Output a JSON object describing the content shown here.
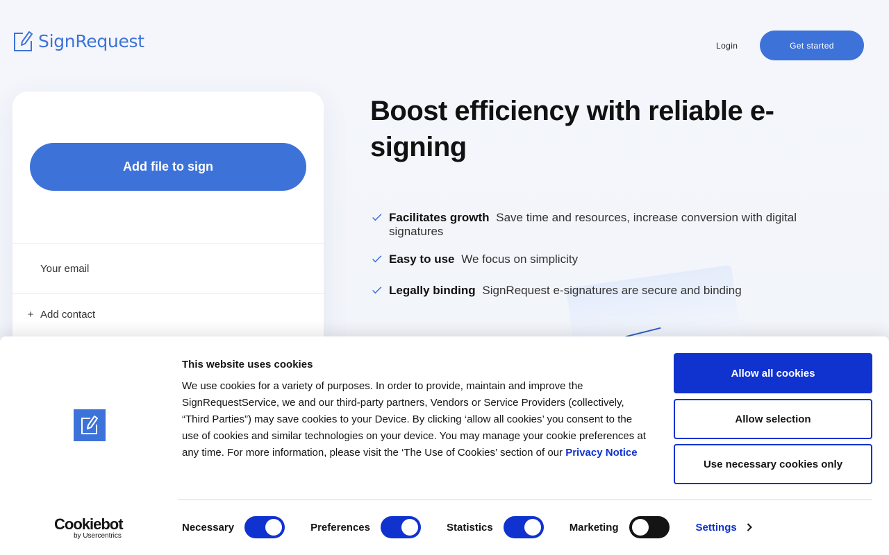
{
  "header": {
    "logo_text": "SignRequest",
    "login_label": "Login",
    "get_started_label": "Get started"
  },
  "card": {
    "add_file_label": "Add file to sign",
    "email_placeholder": "Your email",
    "add_contact_label": "Add contact"
  },
  "hero": {
    "title": "Boost efficiency with reliable e-signing",
    "features": [
      {
        "title": "Facilitates growth",
        "desc": "Save time and resources, increase conversion with digital signatures"
      },
      {
        "title": "Easy to use",
        "desc": "We focus on simplicity"
      },
      {
        "title": "Legally binding",
        "desc": "SignRequest e-signatures are secure and binding"
      }
    ]
  },
  "cookie_banner": {
    "title": "This website uses cookies",
    "body": "We use cookies for a variety of purposes. In order to provide, maintain and improve the SignRequestService, we and our third-party partners, Vendors or Service Providers (collectively, “Third Parties”) may save cookies to your Device. By clicking ‘allow all cookies’ you consent to the use of cookies and similar technologies on your device. You may manage your cookie preferences at any time. For more information, please visit the ‘The Use of Cookies’ section of our ",
    "privacy_link": "Privacy Notice",
    "allow_all_label": "Allow all cookies",
    "allow_selection_label": "Allow selection",
    "necessary_only_label": "Use necessary cookies only",
    "cookiebot_brand": "Cookiebot",
    "cookiebot_sub": "by Usercentrics",
    "toggles": [
      {
        "label": "Necessary",
        "on": true
      },
      {
        "label": "Preferences",
        "on": true
      },
      {
        "label": "Statistics",
        "on": true
      },
      {
        "label": "Marketing",
        "on": false
      }
    ],
    "settings_label": "Settings"
  },
  "colors": {
    "brand_blue": "#3d72d9",
    "cookie_blue": "#1032cf"
  }
}
